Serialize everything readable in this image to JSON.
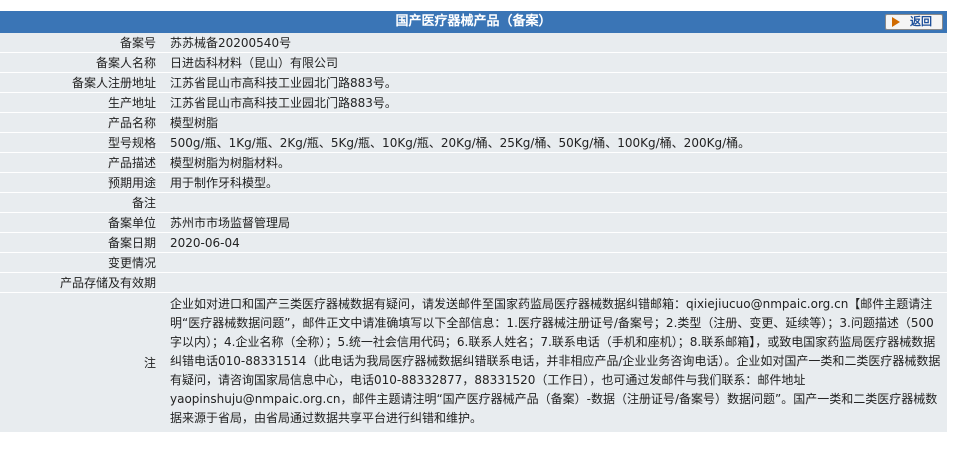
{
  "header": {
    "title": "国产医疗器械产品（备案）",
    "back_label": "返回"
  },
  "rows": [
    {
      "label": "备案号",
      "value": "苏苏械备20200540号"
    },
    {
      "label": "备案人名称",
      "value": "日进齿科材料（昆山）有限公司"
    },
    {
      "label": "备案人注册地址",
      "value": "江苏省昆山市高科技工业园北门路883号。"
    },
    {
      "label": "生产地址",
      "value": "江苏省昆山市高科技工业园北门路883号。"
    },
    {
      "label": "产品名称",
      "value": "模型树脂"
    },
    {
      "label": "型号规格",
      "value": "500g/瓶、1Kg/瓶、2Kg/瓶、5Kg/瓶、10Kg/瓶、20Kg/桶、25Kg/桶、50Kg/桶、100Kg/桶、200Kg/桶。"
    },
    {
      "label": "产品描述",
      "value": "模型树脂为树脂材料。"
    },
    {
      "label": "预期用途",
      "value": "用于制作牙科模型。"
    },
    {
      "label": "备注",
      "value": ""
    },
    {
      "label": "备案单位",
      "value": "苏州市市场监督管理局"
    },
    {
      "label": "备案日期",
      "value": "2020-06-04"
    },
    {
      "label": "变更情况",
      "value": ""
    },
    {
      "label": "产品存储及有效期",
      "value": ""
    }
  ],
  "note": {
    "label": "注",
    "text": "企业如对进口和国产三类医疗器械数据有疑问，请发送邮件至国家药监局医疗器械数据纠错邮箱：qixiejiucuo@nmpaic.org.cn【邮件主题请注明“医疗器械数据问题”，邮件正文中请准确填写以下全部信息：1.医疗器械注册证号/备案号；2.类型（注册、变更、延续等）；3.问题描述（500字以内）；4.企业名称（全称）；5.统一社会信用代码；6.联系人姓名；7.联系电话（手机和座机）；8.联系邮箱】，或致电国家药监局医疗器械数据纠错电话010-88331514（此电话为我局医疗器械数据纠错联系电话，并非相应产品/企业业务咨询电话）。企业如对国产一类和二类医疗器械数据有疑问，请咨询国家局信息中心，电话010-88332877，88331520（工作日），也可通过发邮件与我们联系：邮件地址yaopinshuju@nmpaic.org.cn，邮件主题请注明“国产医疗器械产品（备案）-数据（注册证号/备案号）数据问题”。国产一类和二类医疗器械数据来源于省局，由省局通过数据共享平台进行纠错和维护。"
  },
  "colors": {
    "header_bg": "#3a75b6",
    "row_bg": "#e8ecef"
  },
  "icons": {
    "back": "arrow-right-icon"
  }
}
